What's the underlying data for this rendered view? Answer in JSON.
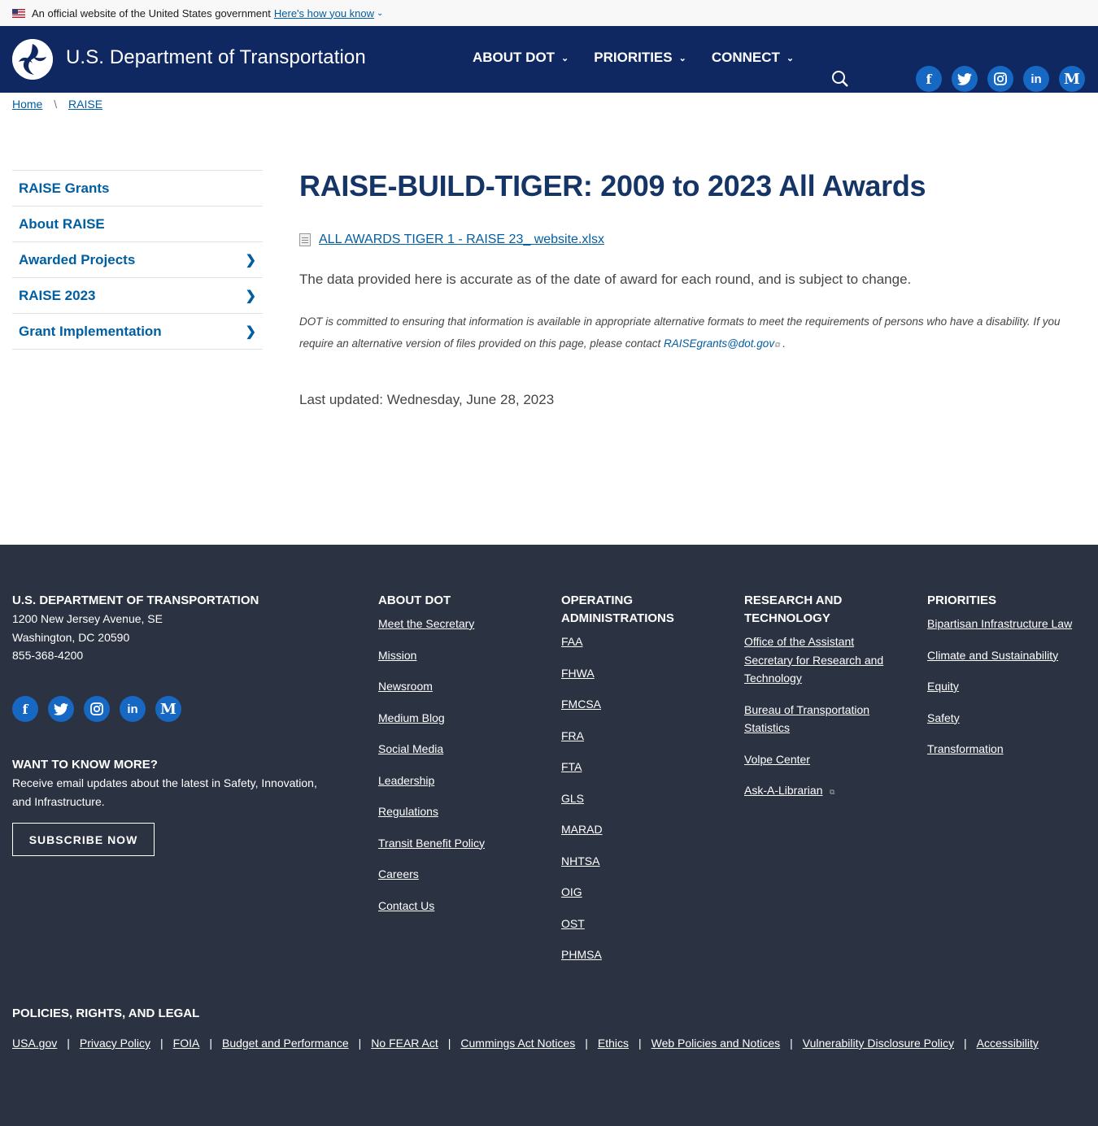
{
  "gov_banner": {
    "text": "An official website of the United States government",
    "link": "Here's how you know"
  },
  "header": {
    "site_title": "U.S. Department of Transportation",
    "nav": [
      "ABOUT DOT",
      "PRIORITIES",
      "CONNECT"
    ],
    "socials": [
      "facebook-icon",
      "twitter-icon",
      "instagram-icon",
      "linkedin-icon",
      "medium-icon"
    ]
  },
  "breadcrumb": [
    "Home",
    "RAISE"
  ],
  "sidenav": [
    {
      "label": "RAISE Grants",
      "has_children": false
    },
    {
      "label": "About RAISE",
      "has_children": false
    },
    {
      "label": "Awarded Projects",
      "has_children": true
    },
    {
      "label": "RAISE 2023",
      "has_children": true
    },
    {
      "label": "Grant Implementation",
      "has_children": true
    }
  ],
  "main": {
    "title": "RAISE-BUILD-TIGER: 2009 to 2023 All Awards",
    "file_link": "ALL AWARDS TIGER 1 - RAISE 23_ website.xlsx",
    "accuracy_note": "The data provided here is accurate as of the date of award for each round, and is subject to change.",
    "alt_note": "DOT is committed to ensuring that information is available in appropriate alternative formats to meet the requirements of persons who have a disability. If you require an alternative version of files provided on this page, please contact",
    "email": "RAISEgrants@dot.gov",
    "period": ".",
    "updated": "Last updated: Wednesday, June 28, 2023"
  },
  "footer": {
    "dept": {
      "head": "U.S. DEPARTMENT OF TRANSPORTATION",
      "address1": "1200 New Jersey Avenue, SE",
      "address2": "Washington, DC 20590",
      "phone": "855-368-4200"
    },
    "want": {
      "head": "WANT TO KNOW MORE?",
      "text": "Receive email updates about the latest in Safety, Innovation, and Infrastructure.",
      "button": "SUBSCRIBE NOW"
    },
    "about": {
      "head": "ABOUT DOT",
      "links": [
        "Meet the Secretary",
        "Mission",
        "Newsroom",
        "Medium Blog",
        "Social Media",
        "Leadership",
        "Regulations",
        "Transit Benefit Policy",
        "Careers",
        "Contact Us"
      ]
    },
    "operating": {
      "head": "OPERATING ADMINISTRATIONS",
      "links": [
        "FAA",
        "FHWA",
        "FMCSA",
        "FRA",
        "FTA",
        "GLS",
        "MARAD",
        "NHTSA",
        "OIG",
        "OST",
        "PHMSA"
      ]
    },
    "research": {
      "head": "RESEARCH AND TECHNOLOGY",
      "links": [
        "Office of the Assistant Secretary for Research and Technology",
        "Bureau of Transportation Statistics",
        "Volpe Center",
        "Ask-A-Librarian"
      ]
    },
    "priorities": {
      "head": "PRIORITIES",
      "links": [
        "Bipartisan Infrastructure Law",
        "Climate and Sustainability",
        "Equity",
        "Safety",
        "Transformation"
      ]
    },
    "policies": {
      "head": "POLICIES, RIGHTS, AND LEGAL",
      "links": [
        "USA.gov",
        "Privacy Policy",
        "FOIA",
        "Budget and Performance",
        "No FEAR Act",
        "Cummings Act Notices",
        "Ethics",
        "Web Policies and Notices",
        "Vulnerability Disclosure Policy",
        "Accessibility"
      ]
    }
  }
}
